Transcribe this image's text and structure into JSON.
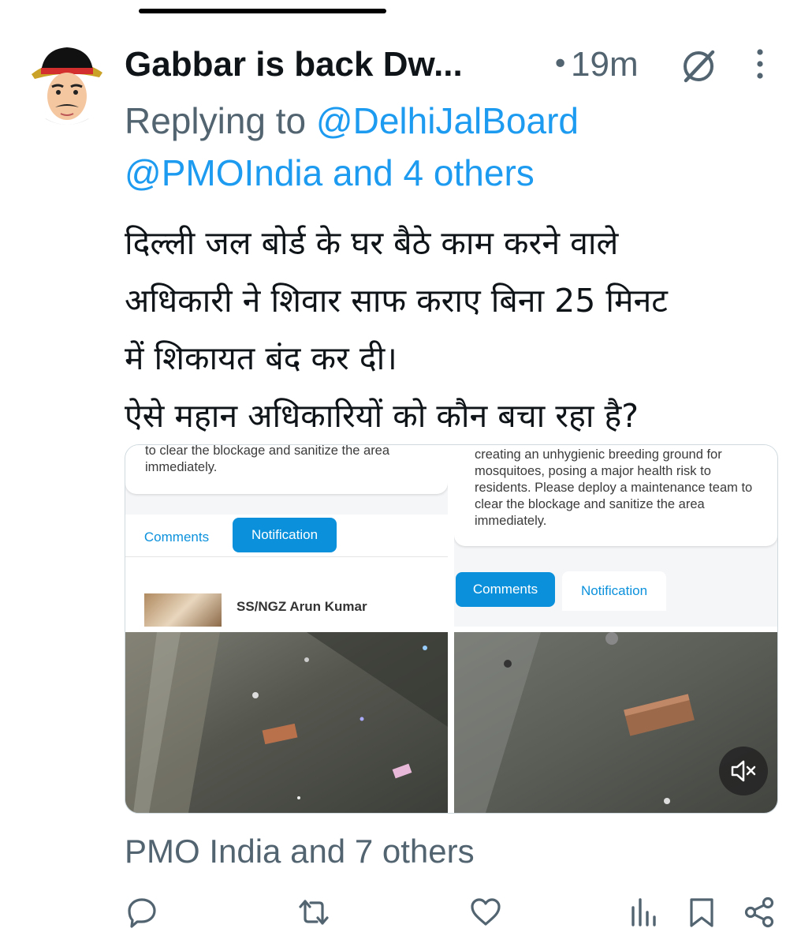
{
  "tweet": {
    "author_name": "Gabbar is back Dw...",
    "separator": "•",
    "timestamp": "19m",
    "reply_prefix": "Replying to",
    "reply_mention_1": "@DelhiJalBoard",
    "reply_mention_2": "@PMOIndia",
    "reply_others": "and 4 others",
    "text_lines": [
      "दिल्ली जल बोर्ड के घर बैठे काम करने वाले",
      "अधिकारी ने शिवार साफ कराए बिना 25 मिनट",
      "में शिकायत बंद कर दी।",
      "ऐसे महान अधिकारियों को कौन बचा रहा है?"
    ],
    "liked_by": "PMO India and 7 others"
  },
  "media": {
    "screenshot_1": {
      "text": "to clear the blockage and sanitize the area immediately.",
      "tab_comments": "Comments",
      "tab_notification": "Notification",
      "commenter": "SS/NGZ Arun Kumar"
    },
    "screenshot_2": {
      "text": "creating an unhygienic breeding ground for mosquitoes, posing a major health risk to residents. Please deploy a maintenance team to clear the blockage and sanitize the area immediately.",
      "tab_comments": "Comments",
      "tab_notification": "Notification"
    }
  },
  "icons": {
    "grok": "grok-icon",
    "more": "more-icon",
    "reply": "reply-icon",
    "retweet": "retweet-icon",
    "like": "heart-icon",
    "views": "views-icon",
    "bookmark": "bookmark-icon",
    "share": "share-icon",
    "mute": "mute-icon"
  },
  "colors": {
    "link": "#1d9bf0",
    "secondary_text": "#536471",
    "tab_blue": "#0b91dc"
  }
}
